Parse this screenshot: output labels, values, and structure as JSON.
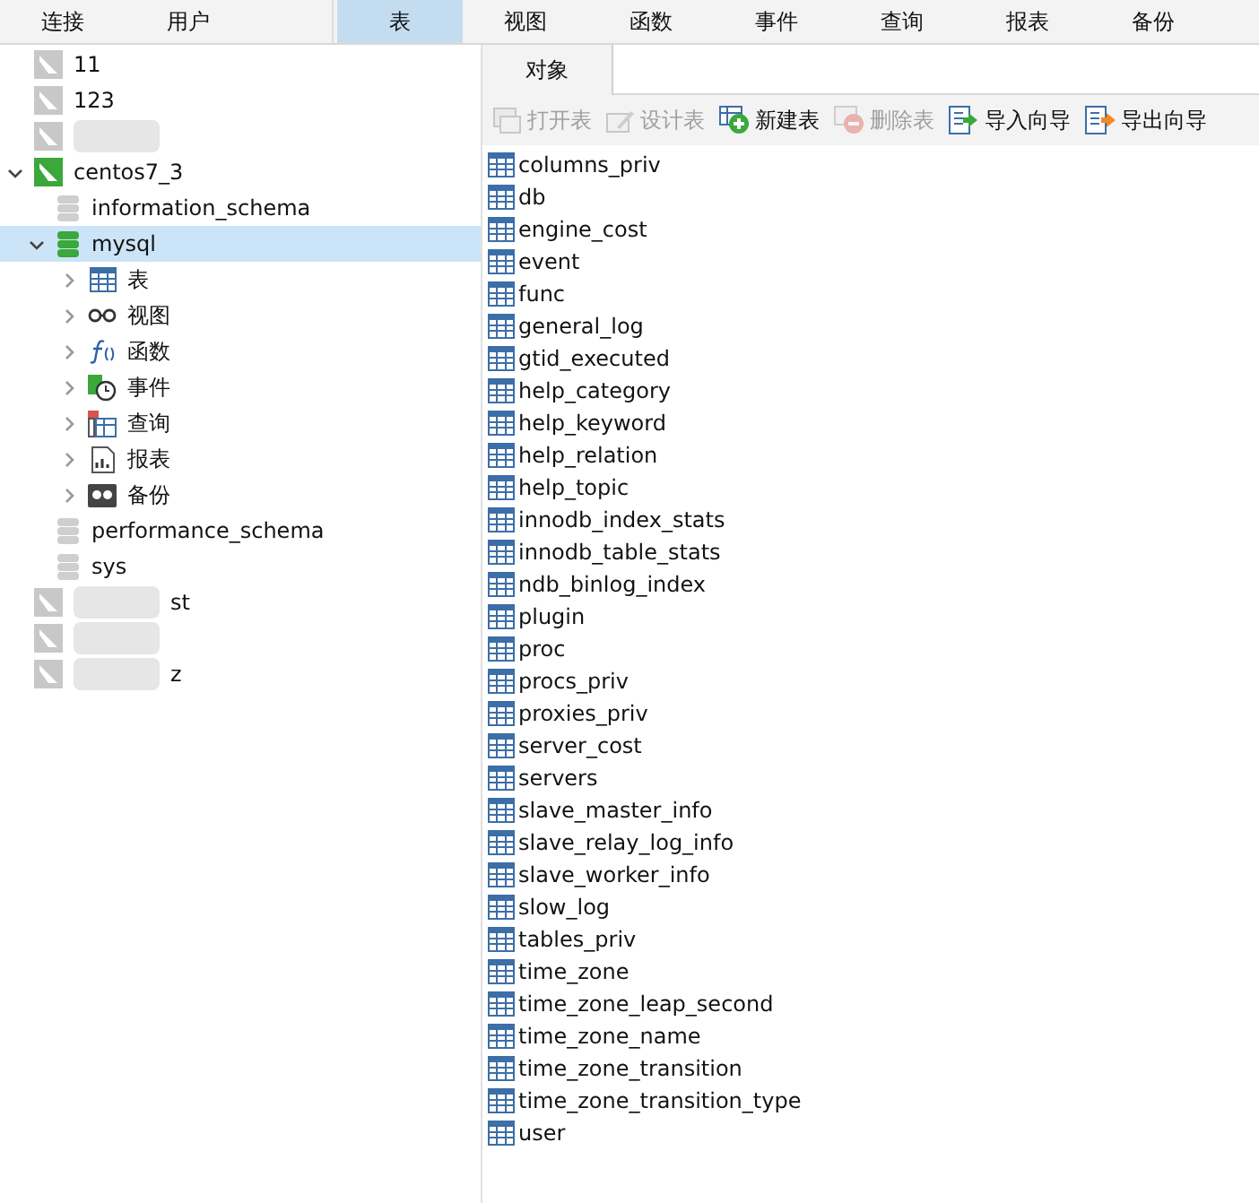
{
  "menu": [
    {
      "label": "连接",
      "selected": false
    },
    {
      "label": "用户",
      "selected": false
    },
    {
      "label": "表",
      "selected": true
    },
    {
      "label": "视图",
      "selected": false
    },
    {
      "label": "函数",
      "selected": false
    },
    {
      "label": "事件",
      "selected": false
    },
    {
      "label": "查询",
      "selected": false
    },
    {
      "label": "报表",
      "selected": false
    },
    {
      "label": "备份",
      "selected": false
    }
  ],
  "tree": [
    {
      "kind": "connection",
      "name": "11",
      "expanded": false
    },
    {
      "kind": "connection",
      "name": "123",
      "expanded": false
    },
    {
      "kind": "connection",
      "redacted": true,
      "expanded": false
    },
    {
      "kind": "connection",
      "name": "centos7_3",
      "active": true,
      "expanded": true,
      "children": [
        {
          "kind": "database",
          "name": "information_schema",
          "expanded": false,
          "selected": false
        },
        {
          "kind": "database",
          "name": "mysql",
          "open": true,
          "expanded": true,
          "selected": true,
          "children": [
            {
              "kind": "tables",
              "name": "表",
              "expanded": false
            },
            {
              "kind": "views",
              "name": "视图",
              "expanded": false
            },
            {
              "kind": "functions",
              "name": "函数",
              "expanded": false
            },
            {
              "kind": "events",
              "name": "事件",
              "expanded": false
            },
            {
              "kind": "queries",
              "name": "查询",
              "expanded": false
            },
            {
              "kind": "reports",
              "name": "报表",
              "expanded": false
            },
            {
              "kind": "backups",
              "name": "备份",
              "expanded": false
            }
          ]
        },
        {
          "kind": "database",
          "name": "performance_schema",
          "expanded": false,
          "selected": false
        },
        {
          "kind": "database",
          "name": "sys",
          "expanded": false,
          "selected": false
        }
      ]
    },
    {
      "kind": "connection",
      "name": "st",
      "redacted": true,
      "expanded": false
    },
    {
      "kind": "connection",
      "redacted": true,
      "expanded": false
    },
    {
      "kind": "connection",
      "name": "z",
      "redacted": true,
      "expanded": false
    }
  ],
  "object_tab": {
    "label": "对象"
  },
  "toolbar": [
    {
      "kind": "open",
      "label": "打开表",
      "disabled": true
    },
    {
      "kind": "design",
      "label": "设计表",
      "disabled": true
    },
    {
      "kind": "new",
      "label": "新建表",
      "disabled": false
    },
    {
      "kind": "delete",
      "label": "删除表",
      "disabled": true
    },
    {
      "kind": "import",
      "label": "导入向导",
      "disabled": false
    },
    {
      "kind": "export",
      "label": "导出向导",
      "disabled": false
    }
  ],
  "tables": [
    "columns_priv",
    "db",
    "engine_cost",
    "event",
    "func",
    "general_log",
    "gtid_executed",
    "help_category",
    "help_keyword",
    "help_relation",
    "help_topic",
    "innodb_index_stats",
    "innodb_table_stats",
    "ndb_binlog_index",
    "plugin",
    "proc",
    "procs_priv",
    "proxies_priv",
    "server_cost",
    "servers",
    "slave_master_info",
    "slave_relay_log_info",
    "slave_worker_info",
    "slow_log",
    "tables_priv",
    "time_zone",
    "time_zone_leap_second",
    "time_zone_name",
    "time_zone_transition",
    "time_zone_transition_type",
    "user"
  ]
}
